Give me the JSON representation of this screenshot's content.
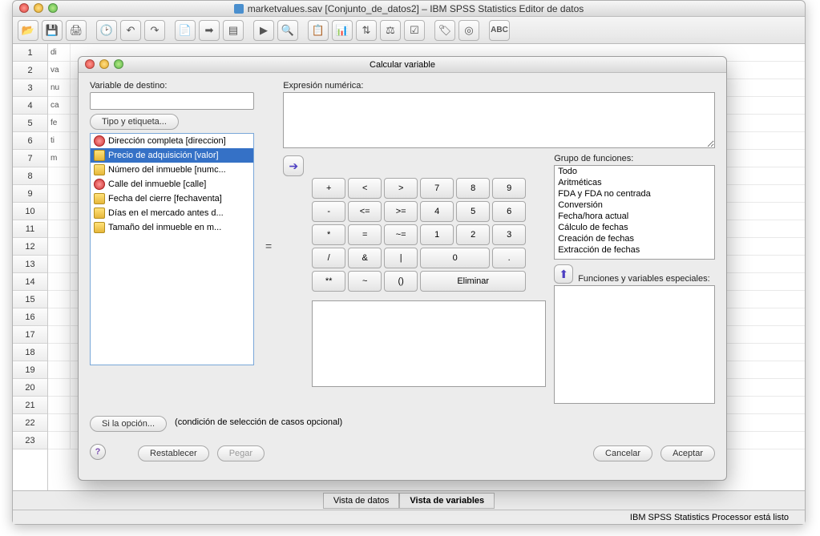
{
  "mainWindow": {
    "title": "marketvalues.sav [Conjunto_de_datos2] – IBM SPSS Statistics Editor de datos",
    "rows": [
      "1",
      "2",
      "3",
      "4",
      "5",
      "6",
      "7",
      "8",
      "9",
      "10",
      "11",
      "12",
      "13",
      "14",
      "15",
      "16",
      "17",
      "18",
      "19",
      "20",
      "21",
      "22",
      "23"
    ],
    "peek": [
      "di",
      "va",
      "nu",
      "ca",
      "fe",
      "ti",
      "m"
    ],
    "tabs": {
      "data": "Vista de datos",
      "vars": "Vista de variables"
    },
    "status": "IBM SPSS Statistics Processor está listo"
  },
  "dialog": {
    "title": "Calcular variable",
    "labels": {
      "target": "Variable de destino:",
      "expr": "Expresión numérica:",
      "typeBtn": "Tipo y etiqueta...",
      "funcGroup": "Grupo de funciones:",
      "funcSpecial": "Funciones y variables especiales:",
      "condHint": "(condición de selección de casos opcional)",
      "condBtn": "Si la opción...",
      "reset": "Restablecer",
      "paste": "Pegar",
      "cancel": "Cancelar",
      "ok": "Aceptar",
      "eliminar": "Eliminar"
    },
    "vars": [
      {
        "icon": "ball",
        "label": "Dirección completa [direccion]"
      },
      {
        "icon": "ruler",
        "label": "Precio de adquisición [valor]",
        "selected": true
      },
      {
        "icon": "ruler",
        "label": "Número del inmueble [numc..."
      },
      {
        "icon": "ball",
        "label": "Calle del inmueble [calle]"
      },
      {
        "icon": "ruler",
        "label": "Fecha del cierre [fechaventa]"
      },
      {
        "icon": "ruler",
        "label": "Días en el mercado antes d..."
      },
      {
        "icon": "ruler",
        "label": "Tamaño del inmueble en m..."
      }
    ],
    "keypad": [
      "+",
      "<",
      ">",
      "7",
      "8",
      "9",
      "-",
      "<=",
      ">=",
      "4",
      "5",
      "6",
      "*",
      "=",
      "~=",
      "1",
      "2",
      "3",
      "/",
      "&",
      "|",
      "0_wide",
      ".",
      "**",
      "~",
      "()",
      "Eliminar_elim"
    ],
    "funcGroups": [
      "Todo",
      "Aritméticas",
      "FDA y FDA no centrada",
      "Conversión",
      "Fecha/hora actual",
      "Cálculo de fechas",
      "Creación de fechas",
      "Extracción de fechas"
    ]
  }
}
